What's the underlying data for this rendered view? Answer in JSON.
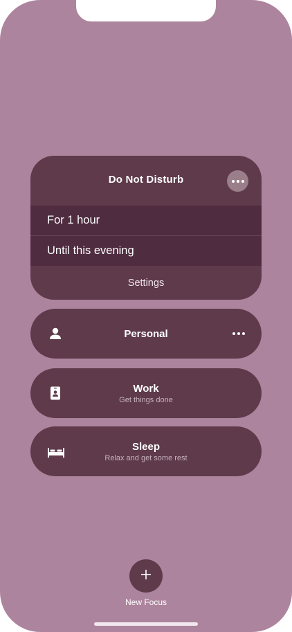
{
  "colors": {
    "background": "#ad849d",
    "card": "#5e3a4b",
    "option": "#4f2c40",
    "accent_button": "#9a7f8a"
  },
  "dnd": {
    "icon": "moon-icon",
    "title": "Do Not Disturb",
    "more_icon": "ellipsis-icon",
    "options": [
      {
        "label": "For 1 hour"
      },
      {
        "label": "Until this evening"
      }
    ],
    "settings_label": "Settings"
  },
  "focus_modes": {
    "personal": {
      "icon": "person-icon",
      "title": "Personal",
      "more_icon": "ellipsis-icon"
    },
    "work": {
      "icon": "id-badge-icon",
      "title": "Work",
      "subtitle": "Get things done"
    },
    "sleep": {
      "icon": "bed-icon",
      "title": "Sleep",
      "subtitle": "Relax and get some rest"
    }
  },
  "new_focus": {
    "icon": "plus-icon",
    "label": "New Focus"
  }
}
